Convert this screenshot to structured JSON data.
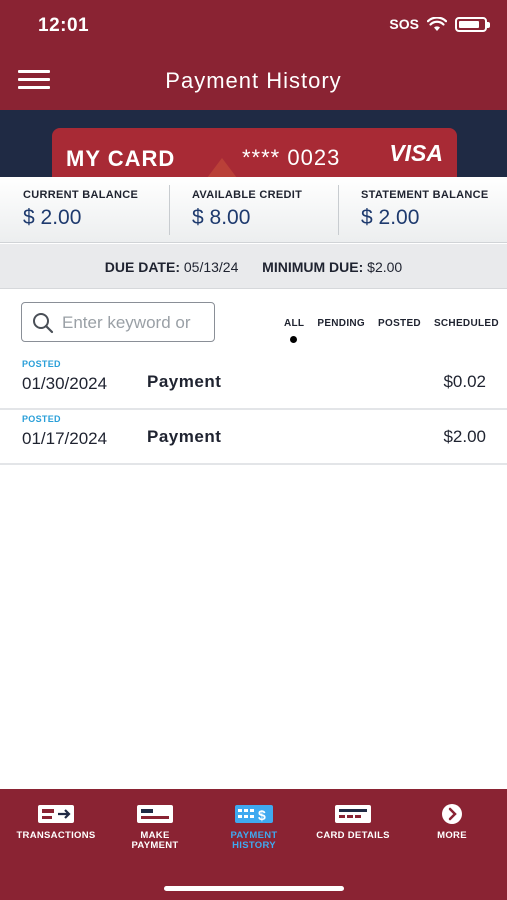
{
  "status_bar": {
    "time": "12:01",
    "carrier": "SOS"
  },
  "header": {
    "title": "Payment History"
  },
  "card": {
    "name": "MY CARD",
    "number": "**** 0023",
    "brand": "VISA"
  },
  "balances": [
    {
      "label": "CURRENT BALANCE",
      "value": "$ 2.00"
    },
    {
      "label": "AVAILABLE CREDIT",
      "value": "$ 8.00"
    },
    {
      "label": "STATEMENT BALANCE",
      "value": "$ 2.00"
    }
  ],
  "due": {
    "date_label": "DUE DATE:",
    "date_value": "05/13/24",
    "min_label": "MINIMUM DUE:",
    "min_value": "$2.00"
  },
  "search": {
    "placeholder": "Enter keyword or"
  },
  "filters": [
    "ALL",
    "PENDING",
    "POSTED",
    "SCHEDULED"
  ],
  "active_filter": "ALL",
  "transactions": [
    {
      "status": "POSTED",
      "date": "01/30/2024",
      "description": "Payment",
      "amount": "$0.02"
    },
    {
      "status": "POSTED",
      "date": "01/17/2024",
      "description": "Payment",
      "amount": "$2.00"
    }
  ],
  "tabs": [
    {
      "label_line1": "TRANSACTIONS",
      "label_line2": "",
      "icon": "transactions-icon",
      "active": false
    },
    {
      "label_line1": "MAKE",
      "label_line2": "PAYMENT",
      "icon": "make-payment-icon",
      "active": false
    },
    {
      "label_line1": "PAYMENT",
      "label_line2": "HISTORY",
      "icon": "payment-history-icon",
      "active": true
    },
    {
      "label_line1": "CARD DETAILS",
      "label_line2": "",
      "icon": "card-details-icon",
      "active": false
    },
    {
      "label_line1": "MORE",
      "label_line2": "",
      "icon": "more-icon",
      "active": false
    }
  ],
  "colors": {
    "brand": "#8a2333",
    "accent": "#3fa9f0",
    "posted": "#2a9fd8",
    "balance_text": "#1e3a6e"
  }
}
